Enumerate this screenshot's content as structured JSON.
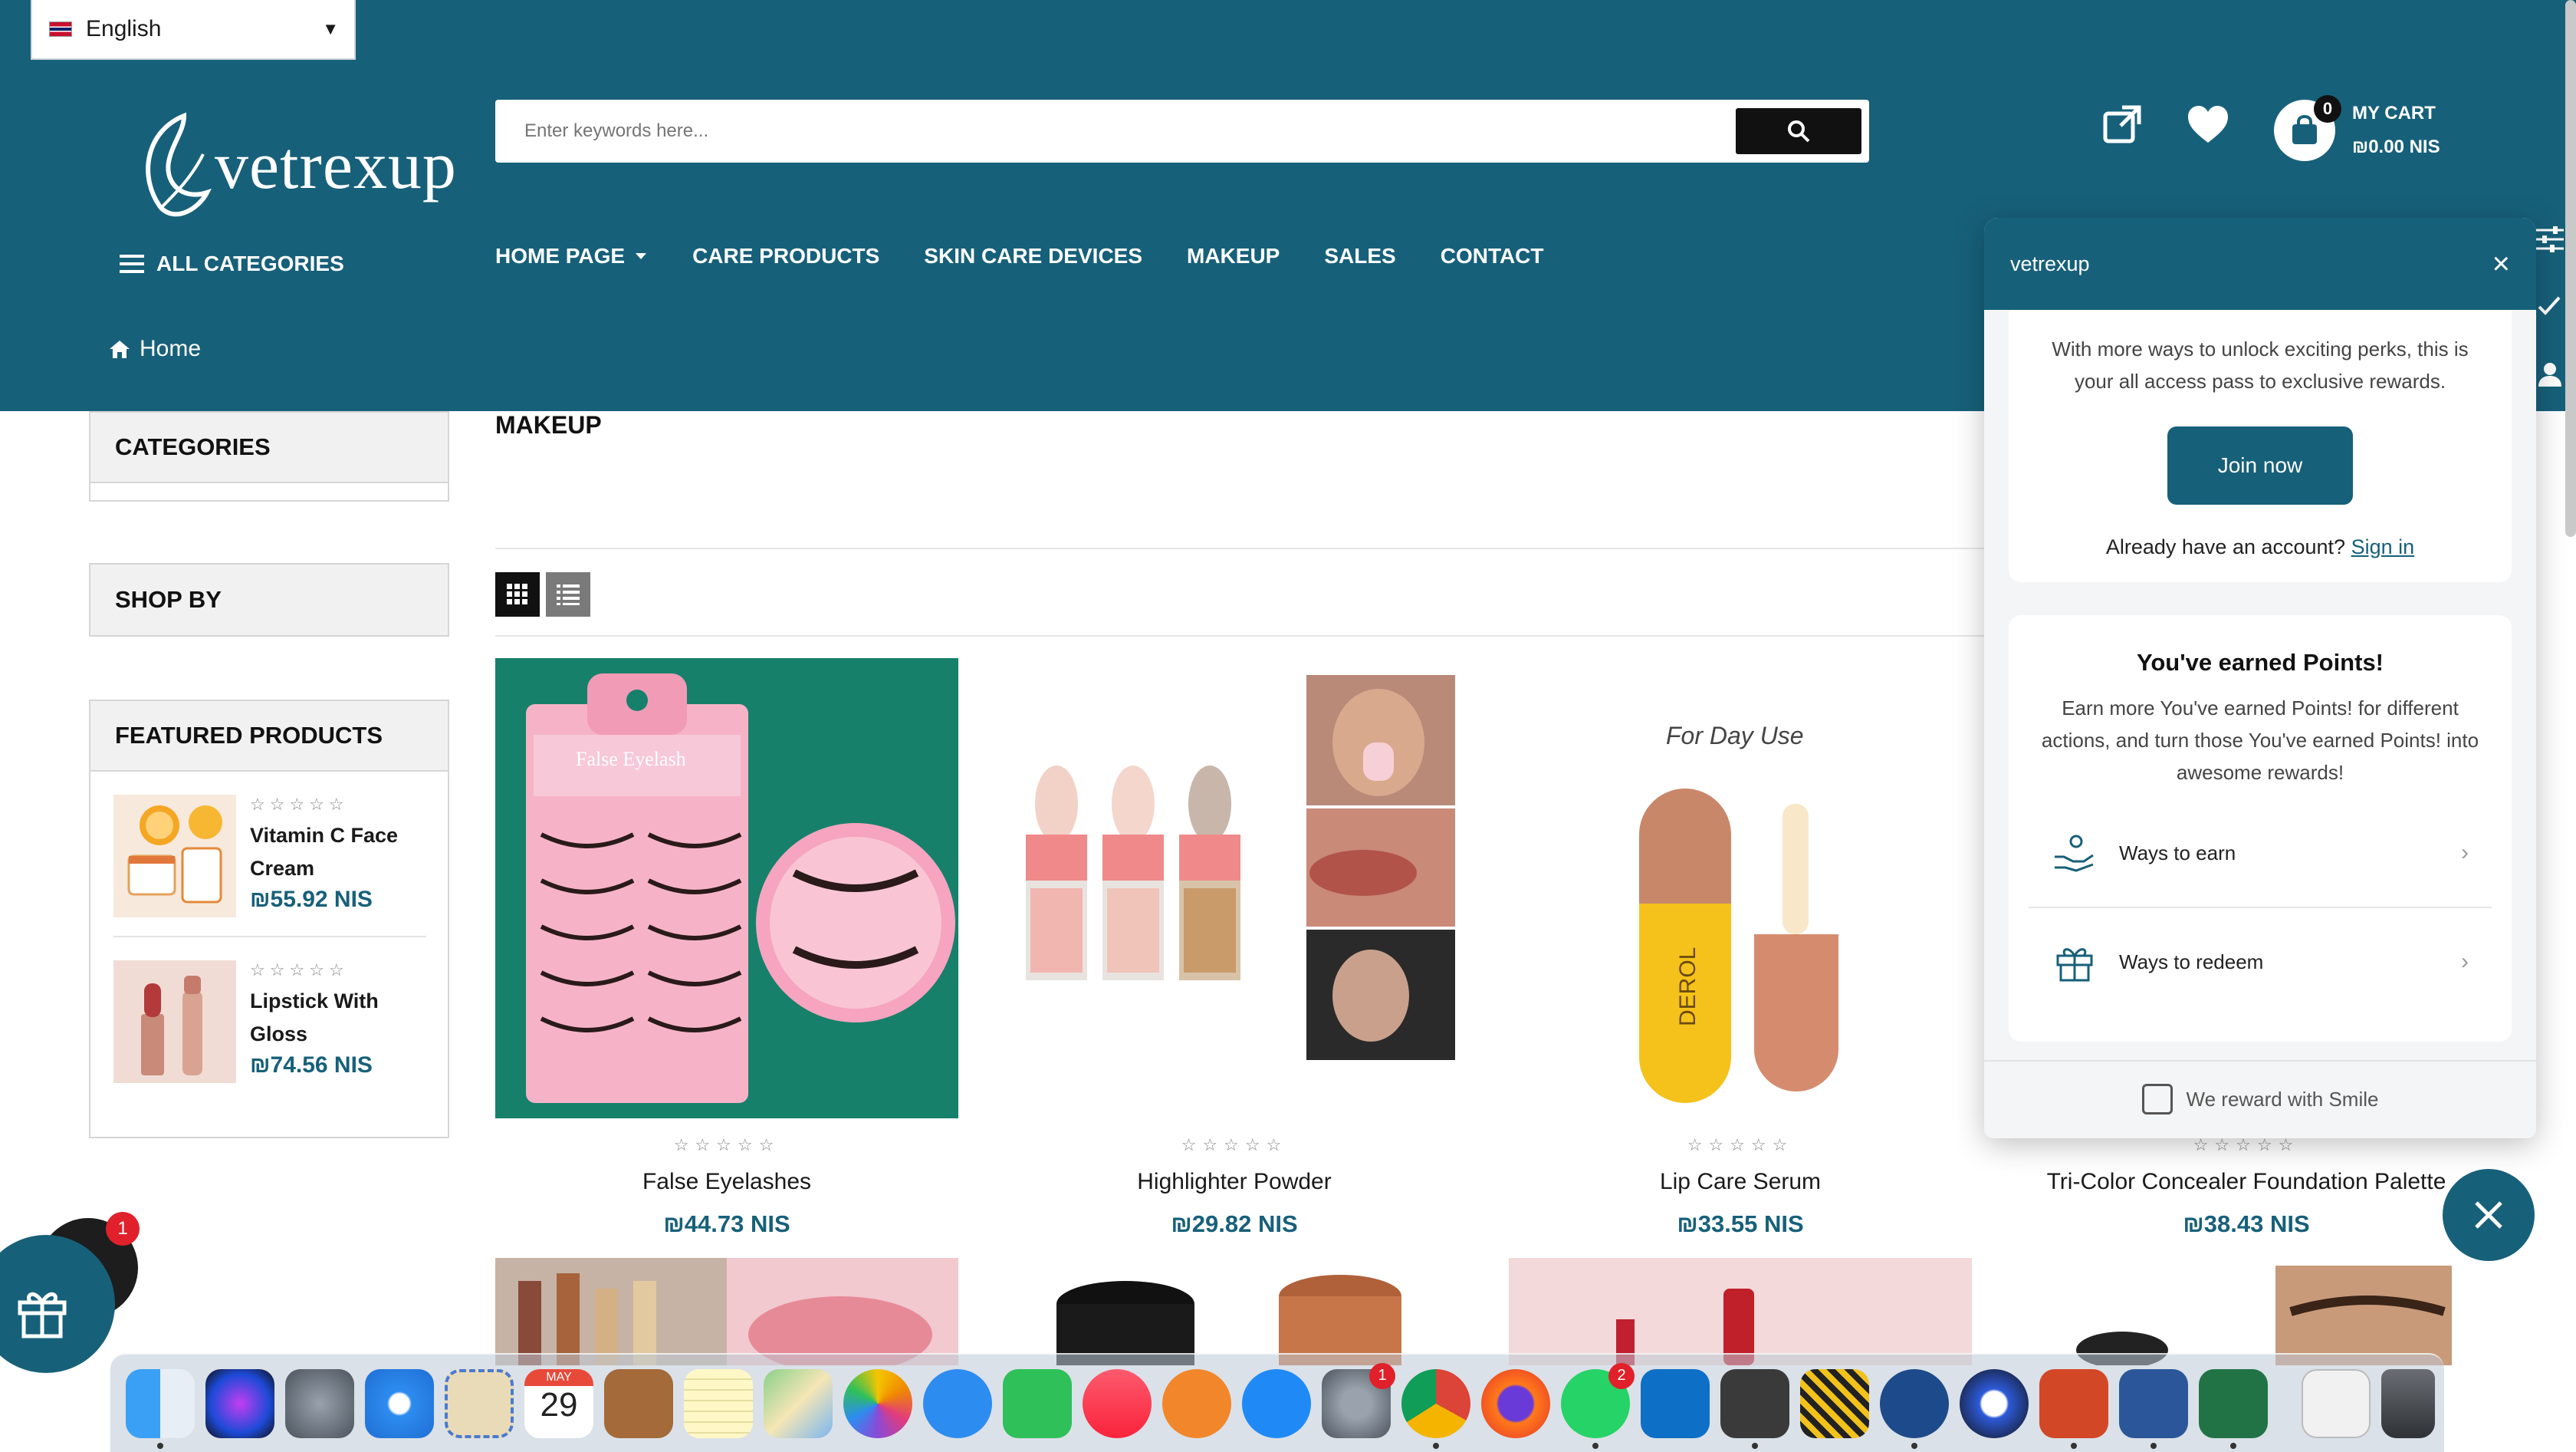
{
  "language": {
    "flag_icon": "uk-flag-icon",
    "label": "English",
    "caret": "▼"
  },
  "brand": {
    "name": "vetrexup"
  },
  "search": {
    "placeholder": "Enter keywords here..."
  },
  "header_icons": [
    "external-link-icon",
    "heart-icon"
  ],
  "cart": {
    "count": "0",
    "label": "MY CART",
    "total": "₪0.00 NIS"
  },
  "nav": {
    "all_categories": "ALL CATEGORIES",
    "items": [
      {
        "label": "HOME PAGE",
        "has_dropdown": true
      },
      {
        "label": "CARE PRODUCTS"
      },
      {
        "label": "SKIN CARE DEVICES"
      },
      {
        "label": "MAKEUP"
      },
      {
        "label": "SALES"
      },
      {
        "label": "CONTACT"
      }
    ]
  },
  "breadcrumb": {
    "home": "Home"
  },
  "sidebar": {
    "categories_title": "CATEGORIES",
    "shopby_title": "SHOP BY",
    "featured_title": "FEATURED PRODUCTS",
    "featured": [
      {
        "name_line1": "Vitamin C Face",
        "name_line2": "Cream",
        "price": "₪55.92 NIS",
        "stars": "☆☆☆☆☆"
      },
      {
        "name_line1": "Lipstick With",
        "name_line2": "Gloss",
        "price": "₪74.56 NIS",
        "stars": "☆☆☆☆☆"
      }
    ]
  },
  "main": {
    "title": "MAKEUP",
    "products": [
      {
        "name": "False Eyelashes",
        "price": "₪44.73 NIS",
        "stars": "☆☆☆☆☆",
        "package_text": "False Eyelash"
      },
      {
        "name": "Highlighter Powder",
        "price": "₪29.82 NIS",
        "stars": "☆☆☆☆☆"
      },
      {
        "name": "Lip Care Serum",
        "price": "₪33.55 NIS",
        "stars": "☆☆☆☆☆",
        "image_caption": "For Day Use",
        "bottle_text": "DEROL"
      },
      {
        "name": "Tri-Color Concealer Foundation Palette",
        "price": "₪38.43 NIS",
        "stars": "☆☆☆☆☆"
      }
    ]
  },
  "smile_panel": {
    "title": "vetrexup",
    "intro": "With more ways to unlock exciting perks, this is your all access pass to exclusive rewards.",
    "join_label": "Join now",
    "already_text": "Already have an account?",
    "signin_label": "Sign in",
    "points_title": "You've earned Points!",
    "points_desc": "Earn more You've earned Points! for different actions, and turn those You've earned Points! into awesome rewards!",
    "earn_label": "Ways to earn",
    "redeem_label": "Ways to redeem",
    "footer": "We reward with Smile"
  },
  "floating": {
    "chat_badge": "1"
  },
  "dock": {
    "calendar_month": "MAY",
    "calendar_day": "29",
    "badges": {
      "settings": "1",
      "whatsapp": "2"
    },
    "apps": [
      "finder-icon",
      "siri-icon",
      "launchpad-icon",
      "safari-icon",
      "mail-icon",
      "calendar-icon",
      "notebook-icon",
      "notes-icon",
      "maps-icon",
      "photos-icon",
      "messages-icon",
      "facetime-icon",
      "music-icon",
      "books-icon",
      "app-store-icon",
      "system-settings-icon",
      "chrome-icon",
      "firefox-icon",
      "whatsapp-icon",
      "vscode-icon",
      "sublime-icon",
      "stack-icon",
      "cyberduck-icon",
      "quicktime-icon",
      "powerpoint-icon",
      "word-icon",
      "excel-icon",
      "download-icon",
      "trash-icon"
    ]
  },
  "colors": {
    "primary": "#17607a",
    "price": "#17607a",
    "text": "#1a1a1a"
  }
}
